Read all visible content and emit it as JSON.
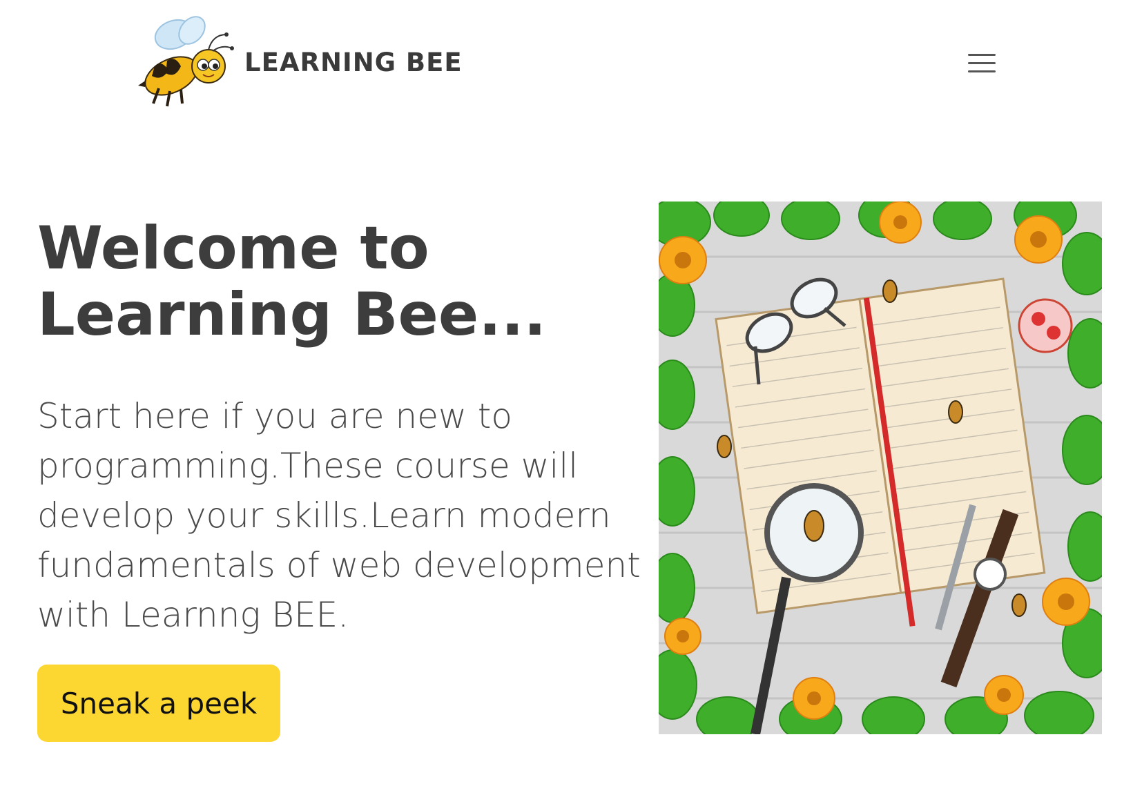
{
  "brand": {
    "name": "LEARNING BEE",
    "logo_icon": "bee-logo-icon"
  },
  "nav": {
    "menu_icon": "hamburger-menu-icon"
  },
  "hero": {
    "title": "Welcome to Learning Bee...",
    "description": "Start here if you are new to programming.These course will develop your skills.Learn modern fundamentals of web development with Learnng BEE.",
    "cta_label": "Sneak a peek",
    "cta_color": "#fcd732",
    "illustration_icon": "notebook-desk-illustration"
  }
}
